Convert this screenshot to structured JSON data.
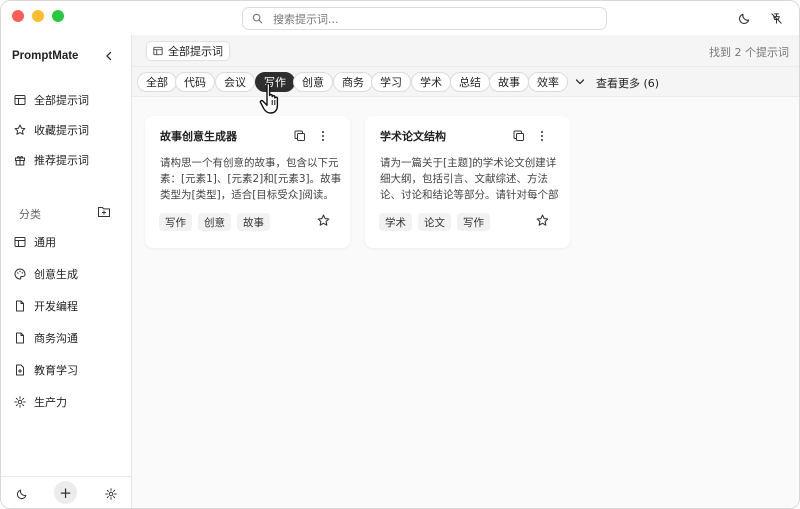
{
  "search": {
    "placeholder": "搜索提示词..."
  },
  "sidebar": {
    "brand": "PromptMate",
    "nav": [
      {
        "label": "全部提示词",
        "icon": "table-icon"
      },
      {
        "label": "收藏提示词",
        "icon": "star-icon"
      },
      {
        "label": "推荐提示词",
        "icon": "gift-icon"
      }
    ],
    "section_label": "分类",
    "categories": [
      {
        "label": "通用",
        "icon": "table-icon"
      },
      {
        "label": "创意生成",
        "icon": "palette-icon"
      },
      {
        "label": "开发编程",
        "icon": "file-icon"
      },
      {
        "label": "商务沟通",
        "icon": "file-icon"
      },
      {
        "label": "教育学习",
        "icon": "file-plus-icon"
      },
      {
        "label": "生产力",
        "icon": "gear-icon"
      }
    ],
    "footer": {
      "add_label": "+"
    }
  },
  "topbar": {
    "crumb": "全部提示词",
    "found": "找到 2 个提示词"
  },
  "tags": {
    "items": [
      "全部",
      "代码",
      "会议",
      "写作",
      "创意",
      "商务",
      "学习",
      "学术",
      "总结",
      "故事",
      "效率"
    ],
    "active": "写作",
    "more_label": "查看更多 (6)"
  },
  "cards": [
    {
      "title": "故事创意生成器",
      "description": "请构思一个有创意的故事，包含以下元素：[元素1]、[元素2]和[元素3]。故事类型为[类型]，适合[目标受众]阅读。",
      "tags": [
        "写作",
        "创意",
        "故事"
      ]
    },
    {
      "title": "学术论文结构",
      "description": "请为一篇关于[主题]的学术论文创建详细大纲，包括引言、文献综述、方法论、讨论和结论等部分。请针对每个部分提供要点。",
      "tags": [
        "学术",
        "论文",
        "写作"
      ]
    }
  ],
  "colors": {
    "accent": "#2e2e2e",
    "traffic_red": "#ff5f57",
    "traffic_yellow": "#febc2e",
    "traffic_green": "#28c840"
  }
}
